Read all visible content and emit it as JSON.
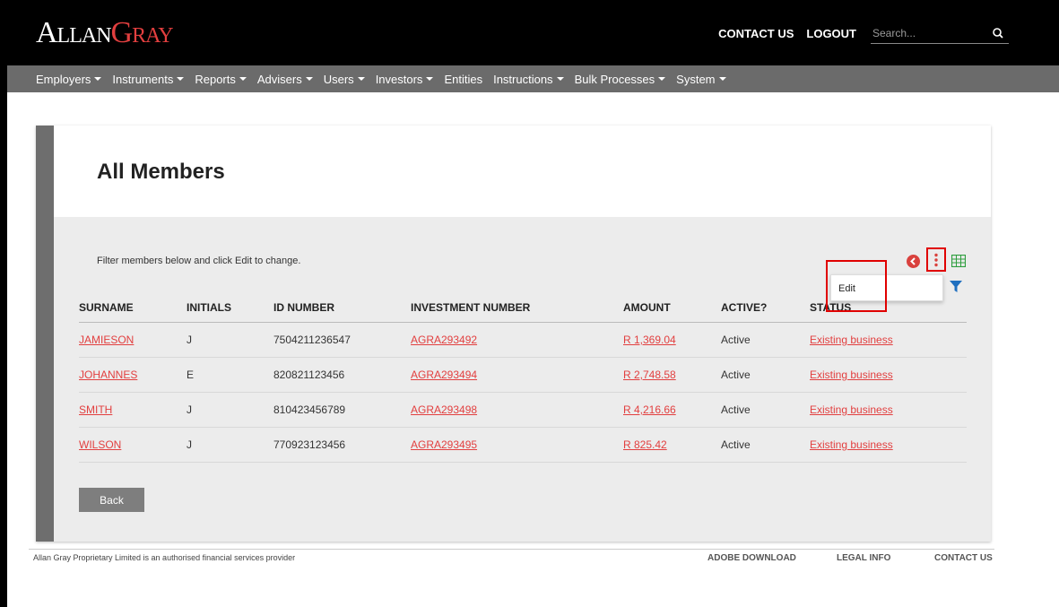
{
  "header": {
    "logo_part1": "Allan",
    "logo_part2": "Gray",
    "contact_us": "CONTACT US",
    "logout": "LOGOUT",
    "search_placeholder": "Search..."
  },
  "nav": {
    "items": [
      {
        "label": "Employers",
        "dropdown": true
      },
      {
        "label": "Instruments",
        "dropdown": true
      },
      {
        "label": "Reports",
        "dropdown": true
      },
      {
        "label": "Advisers",
        "dropdown": true
      },
      {
        "label": "Users",
        "dropdown": true
      },
      {
        "label": "Investors",
        "dropdown": true
      },
      {
        "label": "Entities",
        "dropdown": false
      },
      {
        "label": "Instructions",
        "dropdown": true
      },
      {
        "label": "Bulk Processes",
        "dropdown": true
      },
      {
        "label": "System",
        "dropdown": true
      }
    ]
  },
  "page": {
    "title": "All Members",
    "filter_text": "Filter members below and click Edit to change."
  },
  "menu": {
    "edit": "Edit"
  },
  "table": {
    "headers": [
      "SURNAME",
      "INITIALS",
      "ID NUMBER",
      "INVESTMENT NUMBER",
      "AMOUNT",
      "ACTIVE?",
      "STATUS"
    ],
    "rows": [
      {
        "surname": "JAMIESON",
        "initials": "J",
        "id_number": "7504211236547",
        "investment_number": "AGRA293492",
        "amount": "R 1,369.04",
        "active": "Active",
        "status": "Existing business"
      },
      {
        "surname": "JOHANNES",
        "initials": "E",
        "id_number": "820821123456",
        "investment_number": "AGRA293494",
        "amount": "R 2,748.58",
        "active": "Active",
        "status": "Existing business"
      },
      {
        "surname": "SMITH",
        "initials": "J",
        "id_number": "810423456789",
        "investment_number": "AGRA293498",
        "amount": "R 4,216.66",
        "active": "Active",
        "status": "Existing business"
      },
      {
        "surname": "WILSON",
        "initials": "J",
        "id_number": "770923123456",
        "investment_number": "AGRA293495",
        "amount": "R 825.42",
        "active": "Active",
        "status": "Existing business"
      }
    ]
  },
  "buttons": {
    "back": "Back"
  },
  "footer": {
    "disclaimer": "Allan Gray Proprietary Limited is an authorised financial services provider",
    "adobe_download": "ADOBE DOWNLOAD",
    "legal_info": "LEGAL INFO",
    "contact_us": "CONTACT US"
  },
  "icons": {
    "search": "search-icon",
    "back": "back-circle-icon",
    "kebab": "kebab-menu-icon",
    "grid": "grid-view-icon",
    "filter": "filter-icon"
  },
  "colors": {
    "brand_red": "#e23f3f",
    "nav_gray": "#6b6b6b",
    "highlight_red": "#e00000",
    "grid_green": "#2e9e3e",
    "filter_blue": "#1f6fbf"
  }
}
